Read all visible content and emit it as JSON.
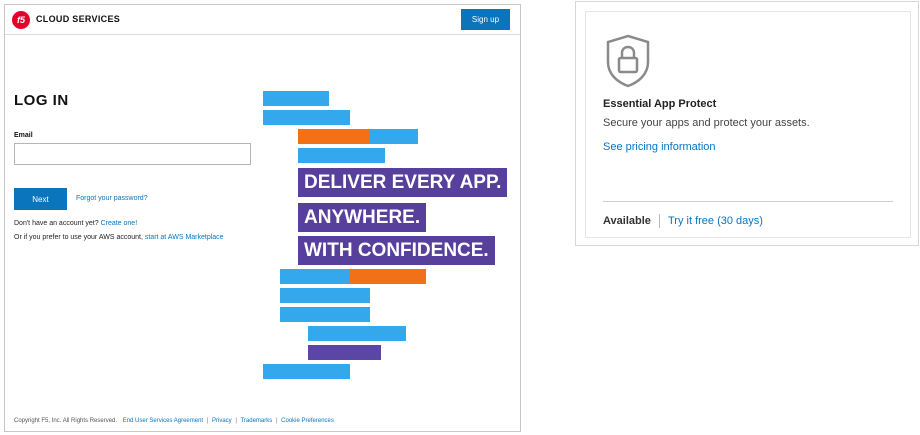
{
  "login": {
    "logo_text": "f5",
    "brand": "CLOUD SERVICES",
    "signup_label": "Sign up",
    "title": "LOG IN",
    "email_label": "Email",
    "email_value": "",
    "next_label": "Next",
    "forgot_link": "Forgot your password?",
    "no_account_text": "Don't have an account yet? ",
    "create_link": "Create one!",
    "aws_text": "Or if you prefer to use your AWS account, ",
    "aws_link": "start at AWS Marketplace",
    "footer": {
      "copyright": "Copyright F5, Inc. All Rights Reserved.",
      "links": [
        "End User Services Agreement",
        "Privacy",
        "Trademarks",
        "Cookie Preferences"
      ]
    }
  },
  "graphic": {
    "taglines": [
      "DELIVER EVERY APP.",
      "ANYWHERE.",
      "WITH CONFIDENCE."
    ],
    "colors": {
      "blue": "#33a8ec",
      "orange": "#f07117",
      "purple": "#5b45a5"
    }
  },
  "card": {
    "icon": "shield-lock-icon",
    "title": "Essential App Protect",
    "description": "Secure your apps and protect your assets.",
    "pricing_link": "See pricing information",
    "status": "Available",
    "trial_link": "Try it free (30 days)"
  },
  "colors": {
    "accent": "#0a74bd",
    "brand_red": "#e4002b"
  }
}
